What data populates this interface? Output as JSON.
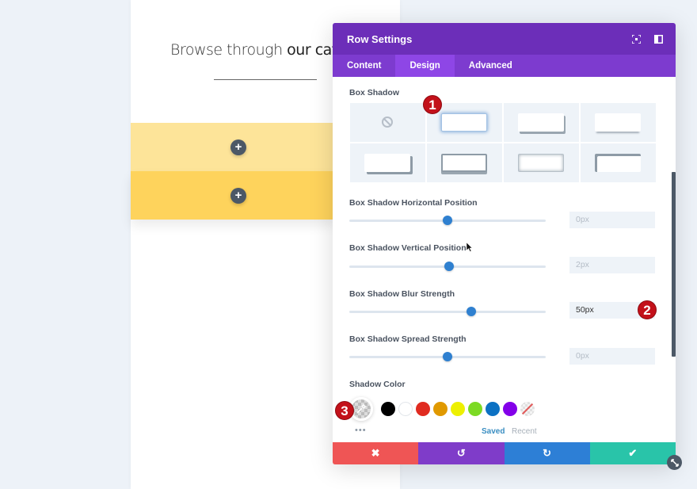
{
  "page": {
    "headline_light": "Browse through ",
    "headline_bold": "our catalo",
    "rows": [
      {
        "add_icon": "+",
        "color": "#fde499"
      },
      {
        "add_icon": "+",
        "color": "#fed35c"
      }
    ]
  },
  "modal": {
    "title": "Row Settings",
    "header_icons": [
      "focus-mode-icon",
      "split-view-icon"
    ],
    "tabs": [
      {
        "label": "Content",
        "active": false
      },
      {
        "label": "Design",
        "active": true
      },
      {
        "label": "Advanced",
        "active": false
      }
    ],
    "box_shadow": {
      "label": "Box Shadow",
      "presets": [
        "none",
        "preset-1",
        "preset-2",
        "preset-3",
        "preset-4",
        "preset-5",
        "preset-6",
        "preset-7"
      ],
      "selected_preset": "preset-1"
    },
    "fields": [
      {
        "label": "Box Shadow Horizontal Position",
        "value": "0px",
        "slider_fraction": 0.5,
        "is_set": false
      },
      {
        "label": "Box Shadow Vertical Position",
        "value": "2px",
        "slider_fraction": 0.51,
        "is_set": false
      },
      {
        "label": "Box Shadow Blur Strength",
        "value": "50px",
        "slider_fraction": 0.62,
        "is_set": true
      },
      {
        "label": "Box Shadow Spread Strength",
        "value": "0px",
        "slider_fraction": 0.5,
        "is_set": false
      }
    ],
    "shadow_color": {
      "label": "Shadow Color",
      "swatches": [
        "#000000",
        "#ffffff",
        "#e02b20",
        "#e09900",
        "#edf000",
        "#7cda24",
        "#0c71c3",
        "#8300e9",
        "transparent"
      ],
      "more": "•••",
      "tab_saved": "Saved",
      "tab_recent": "Recent"
    },
    "footer": {
      "cancel_icon": "✖",
      "undo_icon": "↺",
      "redo_icon": "↻",
      "save_icon": "✔"
    }
  },
  "annotations": {
    "badge1": "1",
    "badge2": "2",
    "badge3": "3"
  },
  "colors": {
    "header": "#6c2eb9",
    "tabs": "#7d3bcf",
    "tab_active": "#8e46e6",
    "slider_knob": "#2f80d0",
    "cancel": "#ef5555",
    "undo": "#7f3cc9",
    "redo": "#2d7fd6",
    "save": "#29c4a9",
    "badge": "#c3111a"
  }
}
